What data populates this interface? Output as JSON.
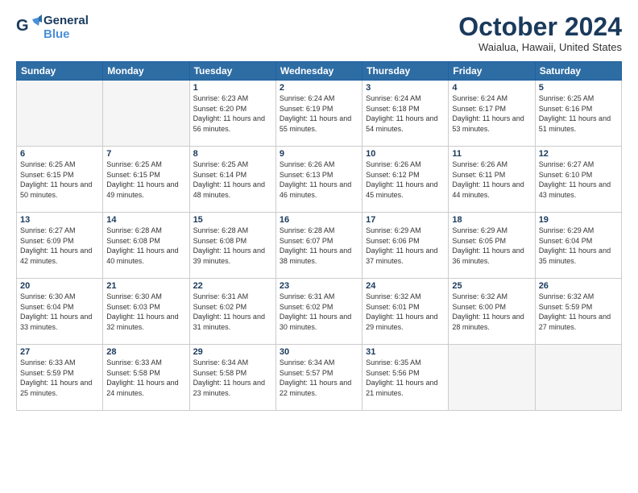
{
  "header": {
    "logo": {
      "line1": "General",
      "line2": "Blue"
    },
    "title": "October 2024",
    "subtitle": "Waialua, Hawaii, United States"
  },
  "weekdays": [
    "Sunday",
    "Monday",
    "Tuesday",
    "Wednesday",
    "Thursday",
    "Friday",
    "Saturday"
  ],
  "weeks": [
    [
      {
        "day": null
      },
      {
        "day": null
      },
      {
        "day": 1,
        "sunrise": "6:23 AM",
        "sunset": "6:20 PM",
        "daylight": "11 hours and 56 minutes."
      },
      {
        "day": 2,
        "sunrise": "6:24 AM",
        "sunset": "6:19 PM",
        "daylight": "11 hours and 55 minutes."
      },
      {
        "day": 3,
        "sunrise": "6:24 AM",
        "sunset": "6:18 PM",
        "daylight": "11 hours and 54 minutes."
      },
      {
        "day": 4,
        "sunrise": "6:24 AM",
        "sunset": "6:17 PM",
        "daylight": "11 hours and 53 minutes."
      },
      {
        "day": 5,
        "sunrise": "6:25 AM",
        "sunset": "6:16 PM",
        "daylight": "11 hours and 51 minutes."
      }
    ],
    [
      {
        "day": 6,
        "sunrise": "6:25 AM",
        "sunset": "6:15 PM",
        "daylight": "11 hours and 50 minutes."
      },
      {
        "day": 7,
        "sunrise": "6:25 AM",
        "sunset": "6:15 PM",
        "daylight": "11 hours and 49 minutes."
      },
      {
        "day": 8,
        "sunrise": "6:25 AM",
        "sunset": "6:14 PM",
        "daylight": "11 hours and 48 minutes."
      },
      {
        "day": 9,
        "sunrise": "6:26 AM",
        "sunset": "6:13 PM",
        "daylight": "11 hours and 46 minutes."
      },
      {
        "day": 10,
        "sunrise": "6:26 AM",
        "sunset": "6:12 PM",
        "daylight": "11 hours and 45 minutes."
      },
      {
        "day": 11,
        "sunrise": "6:26 AM",
        "sunset": "6:11 PM",
        "daylight": "11 hours and 44 minutes."
      },
      {
        "day": 12,
        "sunrise": "6:27 AM",
        "sunset": "6:10 PM",
        "daylight": "11 hours and 43 minutes."
      }
    ],
    [
      {
        "day": 13,
        "sunrise": "6:27 AM",
        "sunset": "6:09 PM",
        "daylight": "11 hours and 42 minutes."
      },
      {
        "day": 14,
        "sunrise": "6:28 AM",
        "sunset": "6:08 PM",
        "daylight": "11 hours and 40 minutes."
      },
      {
        "day": 15,
        "sunrise": "6:28 AM",
        "sunset": "6:08 PM",
        "daylight": "11 hours and 39 minutes."
      },
      {
        "day": 16,
        "sunrise": "6:28 AM",
        "sunset": "6:07 PM",
        "daylight": "11 hours and 38 minutes."
      },
      {
        "day": 17,
        "sunrise": "6:29 AM",
        "sunset": "6:06 PM",
        "daylight": "11 hours and 37 minutes."
      },
      {
        "day": 18,
        "sunrise": "6:29 AM",
        "sunset": "6:05 PM",
        "daylight": "11 hours and 36 minutes."
      },
      {
        "day": 19,
        "sunrise": "6:29 AM",
        "sunset": "6:04 PM",
        "daylight": "11 hours and 35 minutes."
      }
    ],
    [
      {
        "day": 20,
        "sunrise": "6:30 AM",
        "sunset": "6:04 PM",
        "daylight": "11 hours and 33 minutes."
      },
      {
        "day": 21,
        "sunrise": "6:30 AM",
        "sunset": "6:03 PM",
        "daylight": "11 hours and 32 minutes."
      },
      {
        "day": 22,
        "sunrise": "6:31 AM",
        "sunset": "6:02 PM",
        "daylight": "11 hours and 31 minutes."
      },
      {
        "day": 23,
        "sunrise": "6:31 AM",
        "sunset": "6:02 PM",
        "daylight": "11 hours and 30 minutes."
      },
      {
        "day": 24,
        "sunrise": "6:32 AM",
        "sunset": "6:01 PM",
        "daylight": "11 hours and 29 minutes."
      },
      {
        "day": 25,
        "sunrise": "6:32 AM",
        "sunset": "6:00 PM",
        "daylight": "11 hours and 28 minutes."
      },
      {
        "day": 26,
        "sunrise": "6:32 AM",
        "sunset": "5:59 PM",
        "daylight": "11 hours and 27 minutes."
      }
    ],
    [
      {
        "day": 27,
        "sunrise": "6:33 AM",
        "sunset": "5:59 PM",
        "daylight": "11 hours and 25 minutes."
      },
      {
        "day": 28,
        "sunrise": "6:33 AM",
        "sunset": "5:58 PM",
        "daylight": "11 hours and 24 minutes."
      },
      {
        "day": 29,
        "sunrise": "6:34 AM",
        "sunset": "5:58 PM",
        "daylight": "11 hours and 23 minutes."
      },
      {
        "day": 30,
        "sunrise": "6:34 AM",
        "sunset": "5:57 PM",
        "daylight": "11 hours and 22 minutes."
      },
      {
        "day": 31,
        "sunrise": "6:35 AM",
        "sunset": "5:56 PM",
        "daylight": "11 hours and 21 minutes."
      },
      {
        "day": null
      },
      {
        "day": null
      }
    ]
  ]
}
